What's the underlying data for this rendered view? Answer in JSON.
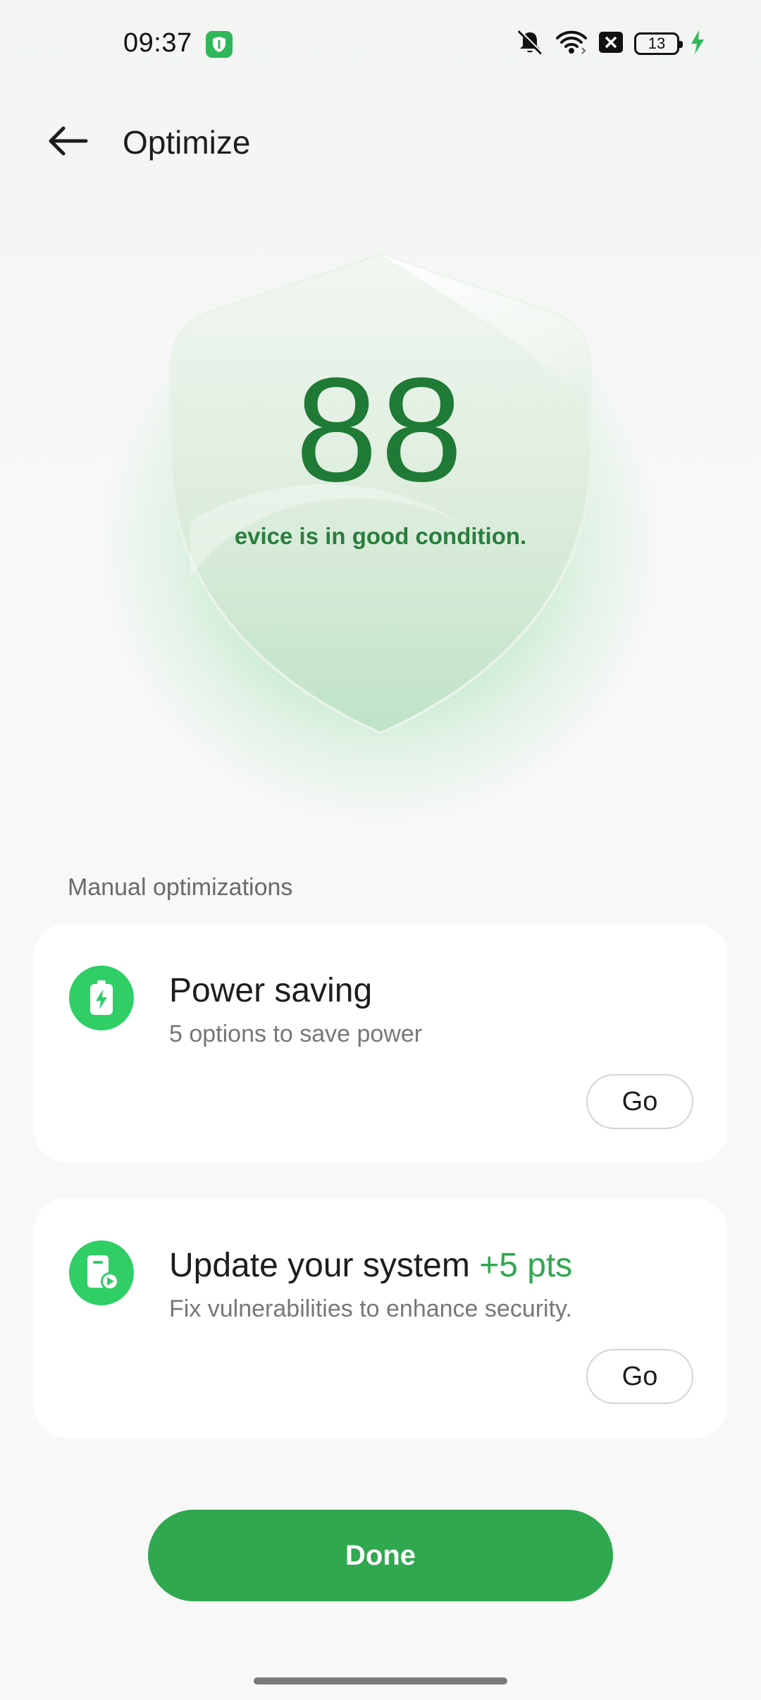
{
  "status_bar": {
    "time": "09:37",
    "battery_level": "13",
    "icons": [
      "security-app-icon",
      "mute-bell-icon",
      "wifi-icon",
      "close-box-icon",
      "battery-icon",
      "charging-bolt-icon"
    ]
  },
  "header": {
    "title": "Optimize",
    "back_icon": "arrow-left-icon"
  },
  "hero": {
    "score": "88",
    "condition": "evice is in good condition."
  },
  "section": {
    "label": "Manual optimizations"
  },
  "cards": [
    {
      "icon": "battery-charging-icon",
      "title": "Power saving",
      "subtitle": "5 options to save power",
      "button_label": "Go"
    },
    {
      "icon": "system-update-icon",
      "title": "Update your system",
      "points": "+5 pts",
      "subtitle": "Fix vulnerabilities to enhance security.",
      "button_label": "Go"
    }
  ],
  "footer": {
    "done_label": "Done"
  },
  "colors": {
    "accent": "#2fa84f",
    "icon_green": "#2fcf66",
    "score_green": "#1f7a35"
  }
}
